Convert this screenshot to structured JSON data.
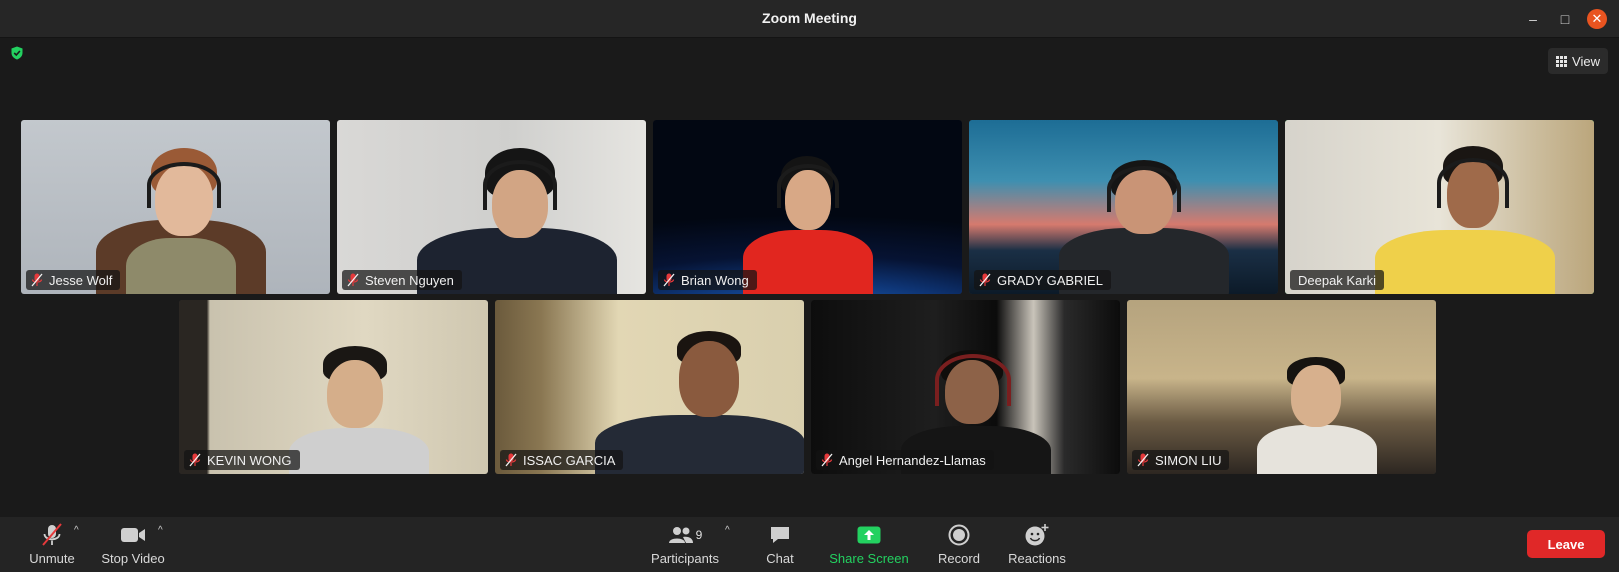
{
  "window": {
    "title": "Zoom Meeting"
  },
  "view_button": {
    "label": "View"
  },
  "participants_tiles": [
    {
      "name": "Jesse Wolf",
      "muted": true,
      "active": false
    },
    {
      "name": "Steven Nguyen",
      "muted": true,
      "active": false
    },
    {
      "name": "Brian Wong",
      "muted": true,
      "active": false
    },
    {
      "name": "GRADY GABRIEL",
      "muted": true,
      "active": false
    },
    {
      "name": "Deepak Karki",
      "muted": false,
      "active": true
    },
    {
      "name": "KEVIN WONG",
      "muted": true,
      "active": false
    },
    {
      "name": "ISSAC GARCIA",
      "muted": true,
      "active": false
    },
    {
      "name": "Angel Hernandez-Llamas",
      "muted": true,
      "active": false
    },
    {
      "name": "SIMON LIU",
      "muted": true,
      "active": false
    }
  ],
  "toolbar": {
    "unmute": "Unmute",
    "stop_video": "Stop Video",
    "participants": "Participants",
    "participants_count": "9",
    "chat": "Chat",
    "share_screen": "Share Screen",
    "record": "Record",
    "reactions": "Reactions",
    "leave": "Leave"
  },
  "colors": {
    "active_speaker": "#23d160",
    "share_screen": "#23d160",
    "leave": "#e02828",
    "close_button": "#e95420"
  }
}
